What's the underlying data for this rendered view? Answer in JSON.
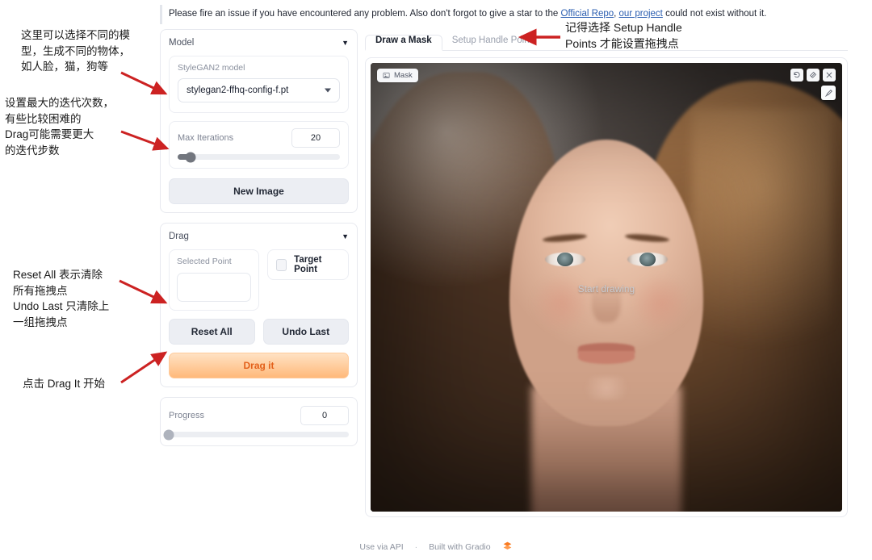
{
  "notice": {
    "text_before": "Please fire an issue if you have encountered any problem. Also don't forgot to give a star to the ",
    "link1": "Official Repo",
    "mid": ", ",
    "link2": "our project",
    "text_after": " could not exist without it."
  },
  "model_panel": {
    "title": "Model",
    "caret_icon": "chevron-down-icon",
    "model_field_label": "StyleGAN2 model",
    "model_value": "stylegan2-ffhq-config-f.pt",
    "slider_label": "Max Iterations",
    "slider_value": "20",
    "slider_percent": 8,
    "new_image_label": "New Image"
  },
  "drag_panel": {
    "title": "Drag",
    "caret_icon": "chevron-down-icon",
    "selected_point_label": "Selected Point",
    "selected_point_value": "",
    "target_point_label": "Target Point",
    "target_point_checked": false,
    "reset_all_label": "Reset All",
    "undo_last_label": "Undo Last",
    "drag_it_label": "Drag it",
    "drag_it_color": "#e3611b"
  },
  "progress_panel": {
    "label": "Progress",
    "value": "0",
    "percent": 0
  },
  "image_panel": {
    "tabs": [
      {
        "label": "Draw a Mask",
        "active": true
      },
      {
        "label": "Setup Handle Points",
        "active": false
      }
    ],
    "mask_badge": "Mask",
    "mask_badge_icon": "image-icon",
    "canvas_hint": "Start drawing",
    "tools": [
      {
        "name": "undo-icon",
        "title": "Undo"
      },
      {
        "name": "eraser-icon",
        "title": "Erase"
      },
      {
        "name": "clear-icon",
        "title": "Clear"
      }
    ],
    "brush_tool": {
      "name": "brush-icon",
      "title": "Brush"
    }
  },
  "footer": {
    "use_via_api": "Use via API",
    "separator": "·",
    "built_with": "Built with Gradio",
    "logo_icon": "gradio-logo-icon"
  },
  "annotations": [
    {
      "id": "anno-model",
      "text": "这里可以选择不同的模\n型，生成不同的物体，\n如人脸，猫，狗等"
    },
    {
      "id": "anno-iterations",
      "text": "设置最大的迭代次数，\n有些比较困难的\nDrag可能需要更大\n的迭代步数"
    },
    {
      "id": "anno-reset",
      "text": "Reset All 表示清除\n所有拖拽点\nUndo Last 只清除上\n一组拖拽点"
    },
    {
      "id": "anno-dragit",
      "text": "点击 Drag It 开始"
    },
    {
      "id": "anno-tabs",
      "text": "记得选择 Setup Handle\nPoints 才能设置拖拽点"
    }
  ],
  "arrow_color": "#cc2222"
}
